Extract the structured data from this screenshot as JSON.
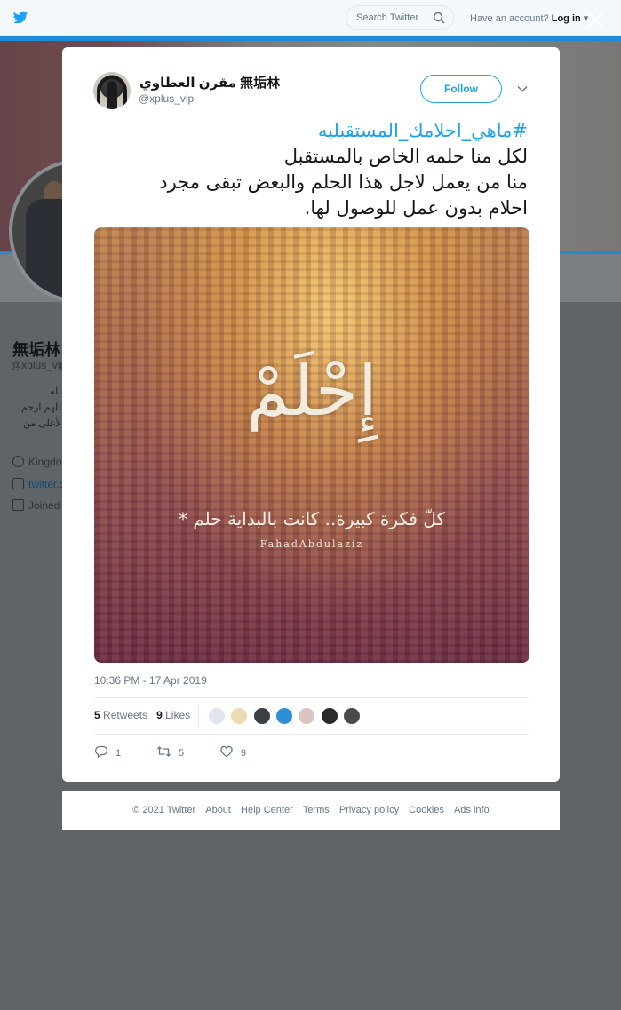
{
  "topbar": {
    "search_placeholder": "Search Twitter",
    "have_account": "Have an account?",
    "login_label": "Log in"
  },
  "background_profile": {
    "name": "無垢林",
    "handle": "@xplus_vip",
    "bio_lines": [
      "الله",
      "اللهم ارحم",
      "الأعلى من"
    ],
    "location": "Kingdo",
    "link": "twitter.c",
    "joined": "Joined"
  },
  "tweet": {
    "display_name": "مقرن العطاوي 無垢林",
    "screen_name": "@xplus_vip",
    "follow_label": "Follow",
    "hashtag": "#ماهي_احلامك_المستقبليه",
    "text_lines": [
      "لكل منا حلمه الخاص بالمستقبل",
      "منا من يعمل لاجل هذا الحلم والبعض تبقى مجرد",
      "احلام بدون عمل للوصول لها."
    ],
    "image": {
      "big_word": "إِحْلَمْ",
      "small_line": "كلّ فكرة كبيرة.. كانت بالبداية حلم *",
      "signature": "FahadAbdulaziz"
    },
    "timestamp": "10:36 PM - 17 Apr 2019",
    "retweets_count": "5",
    "retweets_label": "Retweets",
    "likes_count": "9",
    "likes_label": "Likes",
    "likers": [
      {
        "name": "liker-1",
        "color": "#dfe6ee"
      },
      {
        "name": "liker-2",
        "color": "#e8dcb0"
      },
      {
        "name": "liker-3",
        "color": "#3a3f44"
      },
      {
        "name": "liker-4",
        "color": "#2d8fd5"
      },
      {
        "name": "liker-5",
        "color": "#d9c6c0"
      },
      {
        "name": "liker-6",
        "color": "#2a2a2a"
      },
      {
        "name": "liker-7",
        "color": "#4a4a4a"
      }
    ],
    "actions": {
      "replies": "1",
      "retweets": "5",
      "likes": "9"
    }
  },
  "footer": {
    "copyright": "© 2021 Twitter",
    "about": "About",
    "help": "Help Center",
    "terms": "Terms",
    "privacy": "Privacy policy",
    "cookies": "Cookies",
    "ads": "Ads info"
  },
  "colors": {
    "accent": "#1da1f2",
    "overlay": "#5f6469"
  }
}
